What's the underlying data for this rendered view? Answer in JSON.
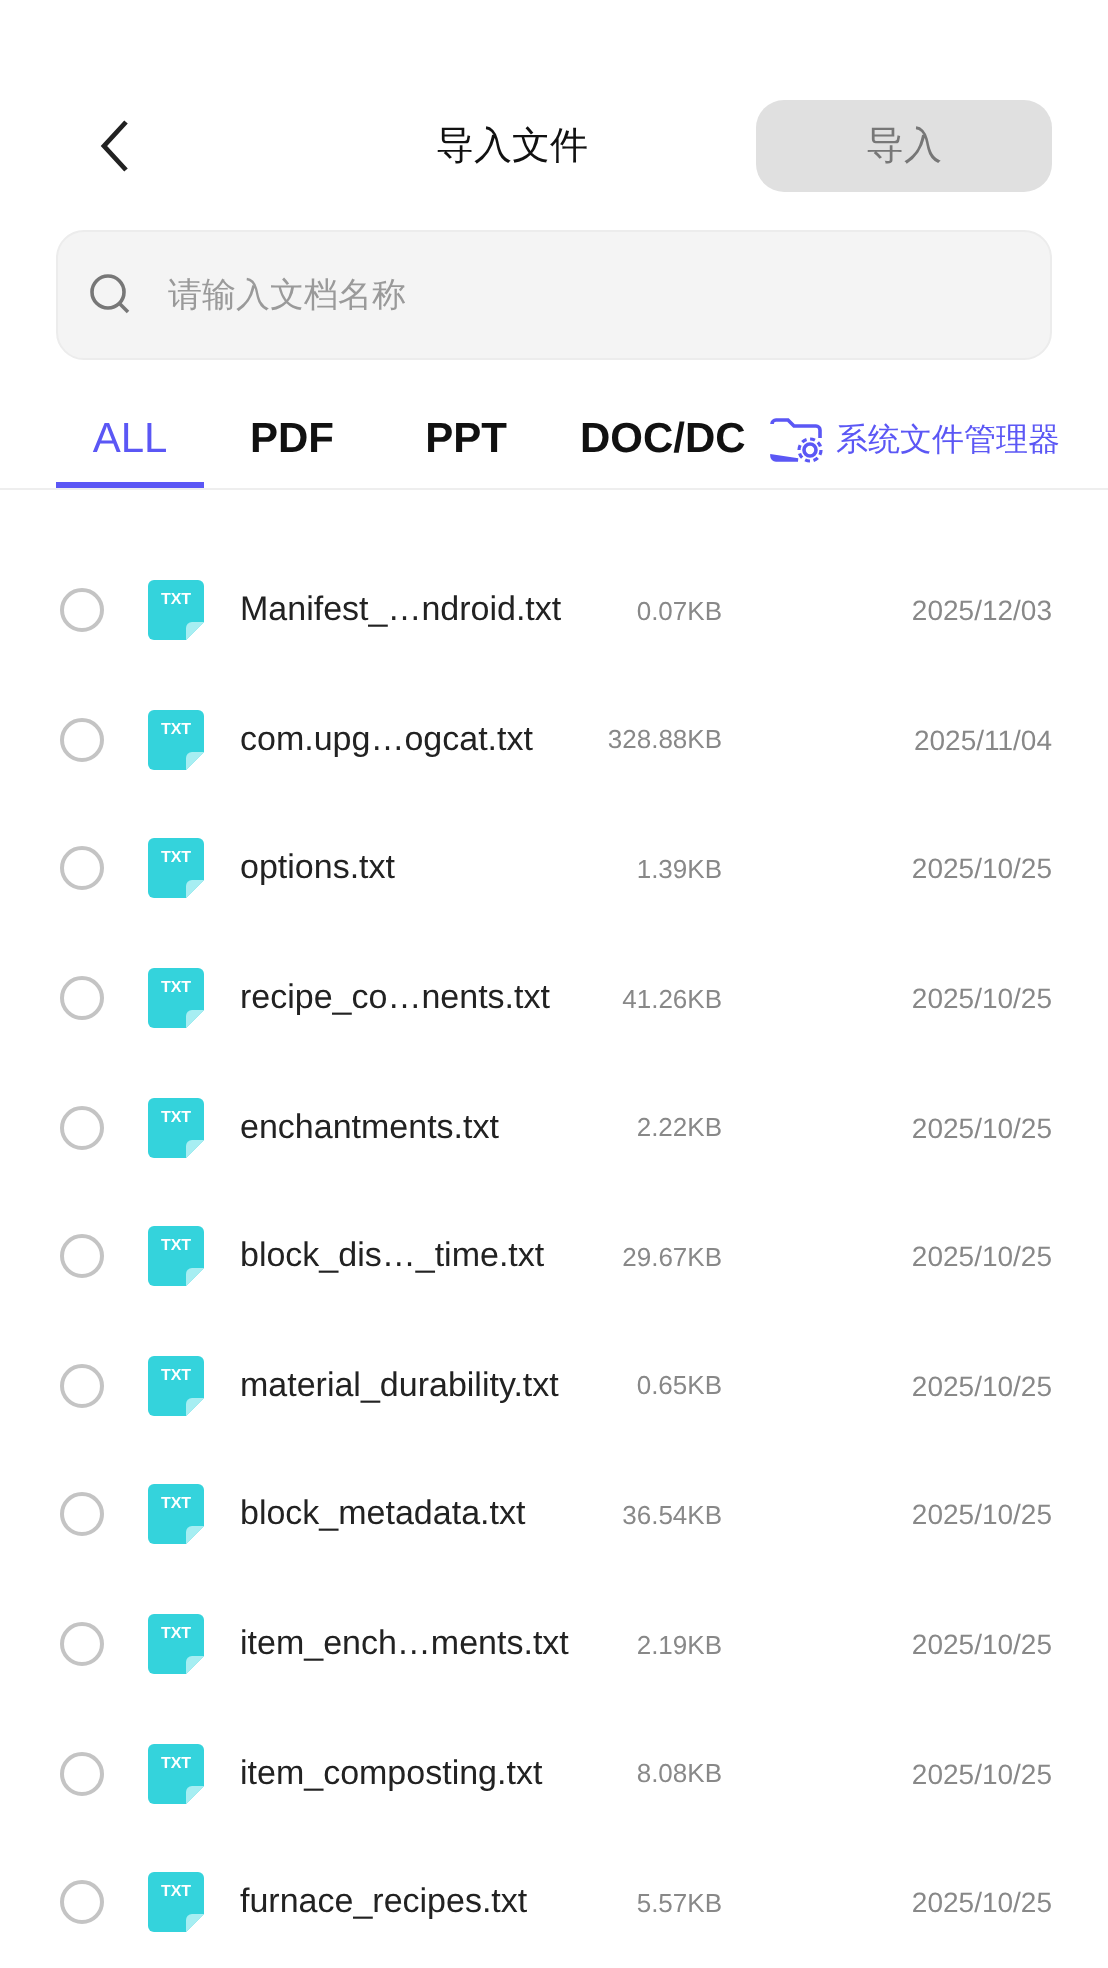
{
  "header": {
    "title": "导入文件",
    "import_button": {
      "label": "导入",
      "disabled": true
    }
  },
  "search": {
    "placeholder": "请输入文档名称"
  },
  "tabs": [
    {
      "label": "ALL",
      "selected": true
    },
    {
      "label": "PDF",
      "selected": false
    },
    {
      "label": "PPT",
      "selected": false
    },
    {
      "label": "DOC/DC",
      "selected": false
    }
  ],
  "file_manager": {
    "label": "系统文件管理器"
  },
  "files": [
    {
      "icon_label": "TXT",
      "name": "Manifest_…ndroid.txt",
      "size": "0.07KB",
      "date": "2025/12/03",
      "selected": false
    },
    {
      "icon_label": "TXT",
      "name": "com.upg…ogcat.txt",
      "size": "328.88KB",
      "date": "2025/11/04",
      "selected": false
    },
    {
      "icon_label": "TXT",
      "name": "options.txt",
      "size": "1.39KB",
      "date": "2025/10/25",
      "selected": false
    },
    {
      "icon_label": "TXT",
      "name": "recipe_co…nents.txt",
      "size": "41.26KB",
      "date": "2025/10/25",
      "selected": false
    },
    {
      "icon_label": "TXT",
      "name": "enchantments.txt",
      "size": "2.22KB",
      "date": "2025/10/25",
      "selected": false
    },
    {
      "icon_label": "TXT",
      "name": "block_dis…_time.txt",
      "size": "29.67KB",
      "date": "2025/10/25",
      "selected": false
    },
    {
      "icon_label": "TXT",
      "name": "material_durability.txt",
      "size": "0.65KB",
      "date": "2025/10/25",
      "selected": false
    },
    {
      "icon_label": "TXT",
      "name": "block_metadata.txt",
      "size": "36.54KB",
      "date": "2025/10/25",
      "selected": false
    },
    {
      "icon_label": "TXT",
      "name": "item_ench…ments.txt",
      "size": "2.19KB",
      "date": "2025/10/25",
      "selected": false
    },
    {
      "icon_label": "TXT",
      "name": "item_composting.txt",
      "size": "8.08KB",
      "date": "2025/10/25",
      "selected": false
    },
    {
      "icon_label": "TXT",
      "name": "furnace_recipes.txt",
      "size": "5.57KB",
      "date": "2025/10/25",
      "selected": false
    }
  ]
}
